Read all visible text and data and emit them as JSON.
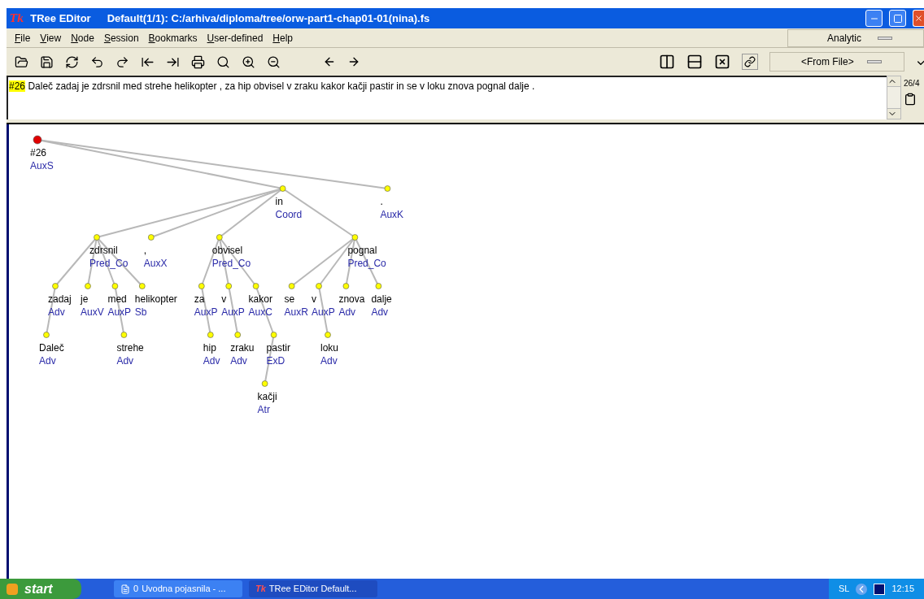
{
  "window": {
    "logo": "Tk",
    "title": "TRee EDitor",
    "document": "Default(1/1): C:/arhiva/diploma/tree/orw-part1-chap01-01(nina).fs"
  },
  "menu": [
    {
      "mnemonic": "F",
      "rest": "ile"
    },
    {
      "mnemonic": "V",
      "rest": "iew"
    },
    {
      "mnemonic": "N",
      "rest": "ode"
    },
    {
      "mnemonic": "S",
      "rest": "ession"
    },
    {
      "mnemonic": "B",
      "rest": "ookmarks"
    },
    {
      "mnemonic": "U",
      "rest": "ser-defined"
    },
    {
      "mnemonic": "H",
      "rest": "elp"
    }
  ],
  "mode_select": {
    "value": "Analytic"
  },
  "style_select": {
    "value": "<From File>"
  },
  "sentence": {
    "number": "#26",
    "text": "Daleč zadaj je zdrsnil med strehe helikopter , za hip obvisel v zraku kakor kačji pastir in se v loku znova pognal dalje ."
  },
  "position": "26/4",
  "tree": {
    "word": "#26",
    "afun": "AuxS",
    "color": "#e00000",
    "children": [
      {
        "word": "in",
        "afun": "Coord",
        "color": "#ffff00",
        "left": false,
        "children": [
          {
            "word": "zdrsnil",
            "afun": "Pred_Co",
            "color": "#ffff00",
            "left": true,
            "children": [
              {
                "word": "zadaj",
                "afun": "Adv",
                "color": "#ffff00",
                "left": true,
                "children": [
                  {
                    "word": "Daleč",
                    "afun": "Adv",
                    "color": "#ffff00",
                    "left": true
                  }
                ]
              },
              {
                "word": "je",
                "afun": "AuxV",
                "color": "#ffff00",
                "left": true
              },
              {
                "word": "med",
                "afun": "AuxP",
                "color": "#ffff00",
                "left": false,
                "children": [
                  {
                    "word": "strehe",
                    "afun": "Adv",
                    "color": "#ffff00",
                    "left": false
                  }
                ]
              },
              {
                "word": "helikopter",
                "afun": "Sb",
                "color": "#ffff00",
                "left": false
              }
            ]
          },
          {
            "word": ",",
            "afun": "AuxX",
            "color": "#ffff00",
            "left": true
          },
          {
            "word": "obvisel",
            "afun": "Pred_Co",
            "color": "#ffff00",
            "left": true,
            "children": [
              {
                "word": "za",
                "afun": "AuxP",
                "color": "#ffff00",
                "left": true,
                "children": [
                  {
                    "word": "hip",
                    "afun": "Adv",
                    "color": "#ffff00",
                    "left": false
                  }
                ]
              },
              {
                "word": "v",
                "afun": "AuxP",
                "color": "#ffff00",
                "left": false,
                "children": [
                  {
                    "word": "zraku",
                    "afun": "Adv",
                    "color": "#ffff00",
                    "left": false
                  }
                ]
              },
              {
                "word": "kakor",
                "afun": "AuxC",
                "color": "#ffff00",
                "left": false,
                "children": [
                  {
                    "word": "pastir",
                    "afun": "ExD",
                    "color": "#ffff00",
                    "left": false,
                    "children": [
                      {
                        "word": "kačji",
                        "afun": "Atr",
                        "color": "#ffff00",
                        "left": true
                      }
                    ]
                  }
                ]
              }
            ]
          },
          {
            "word": "pognal",
            "afun": "Pred_Co",
            "color": "#ffff00",
            "left": false,
            "children": [
              {
                "word": "se",
                "afun": "AuxR",
                "color": "#ffff00",
                "left": true
              },
              {
                "word": "v",
                "afun": "AuxP",
                "color": "#ffff00",
                "left": true,
                "children": [
                  {
                    "word": "loku",
                    "afun": "Adv",
                    "color": "#ffff00",
                    "left": false
                  }
                ]
              },
              {
                "word": "znova",
                "afun": "Adv",
                "color": "#ffff00",
                "left": true
              },
              {
                "word": "dalje",
                "afun": "Adv",
                "color": "#ffff00",
                "left": false
              }
            ]
          }
        ]
      },
      {
        "word": ".",
        "afun": "AuxK",
        "color": "#ffff00",
        "left": false
      }
    ]
  },
  "taskbar": {
    "start": "start",
    "tasks": [
      {
        "logo": "0",
        "label": "Uvodna pojasnila - ...",
        "selected": false
      },
      {
        "logo": "Tk",
        "label": "TRee EDitor    Default...",
        "selected": true
      }
    ],
    "language": "SL",
    "clock": "12:15"
  }
}
